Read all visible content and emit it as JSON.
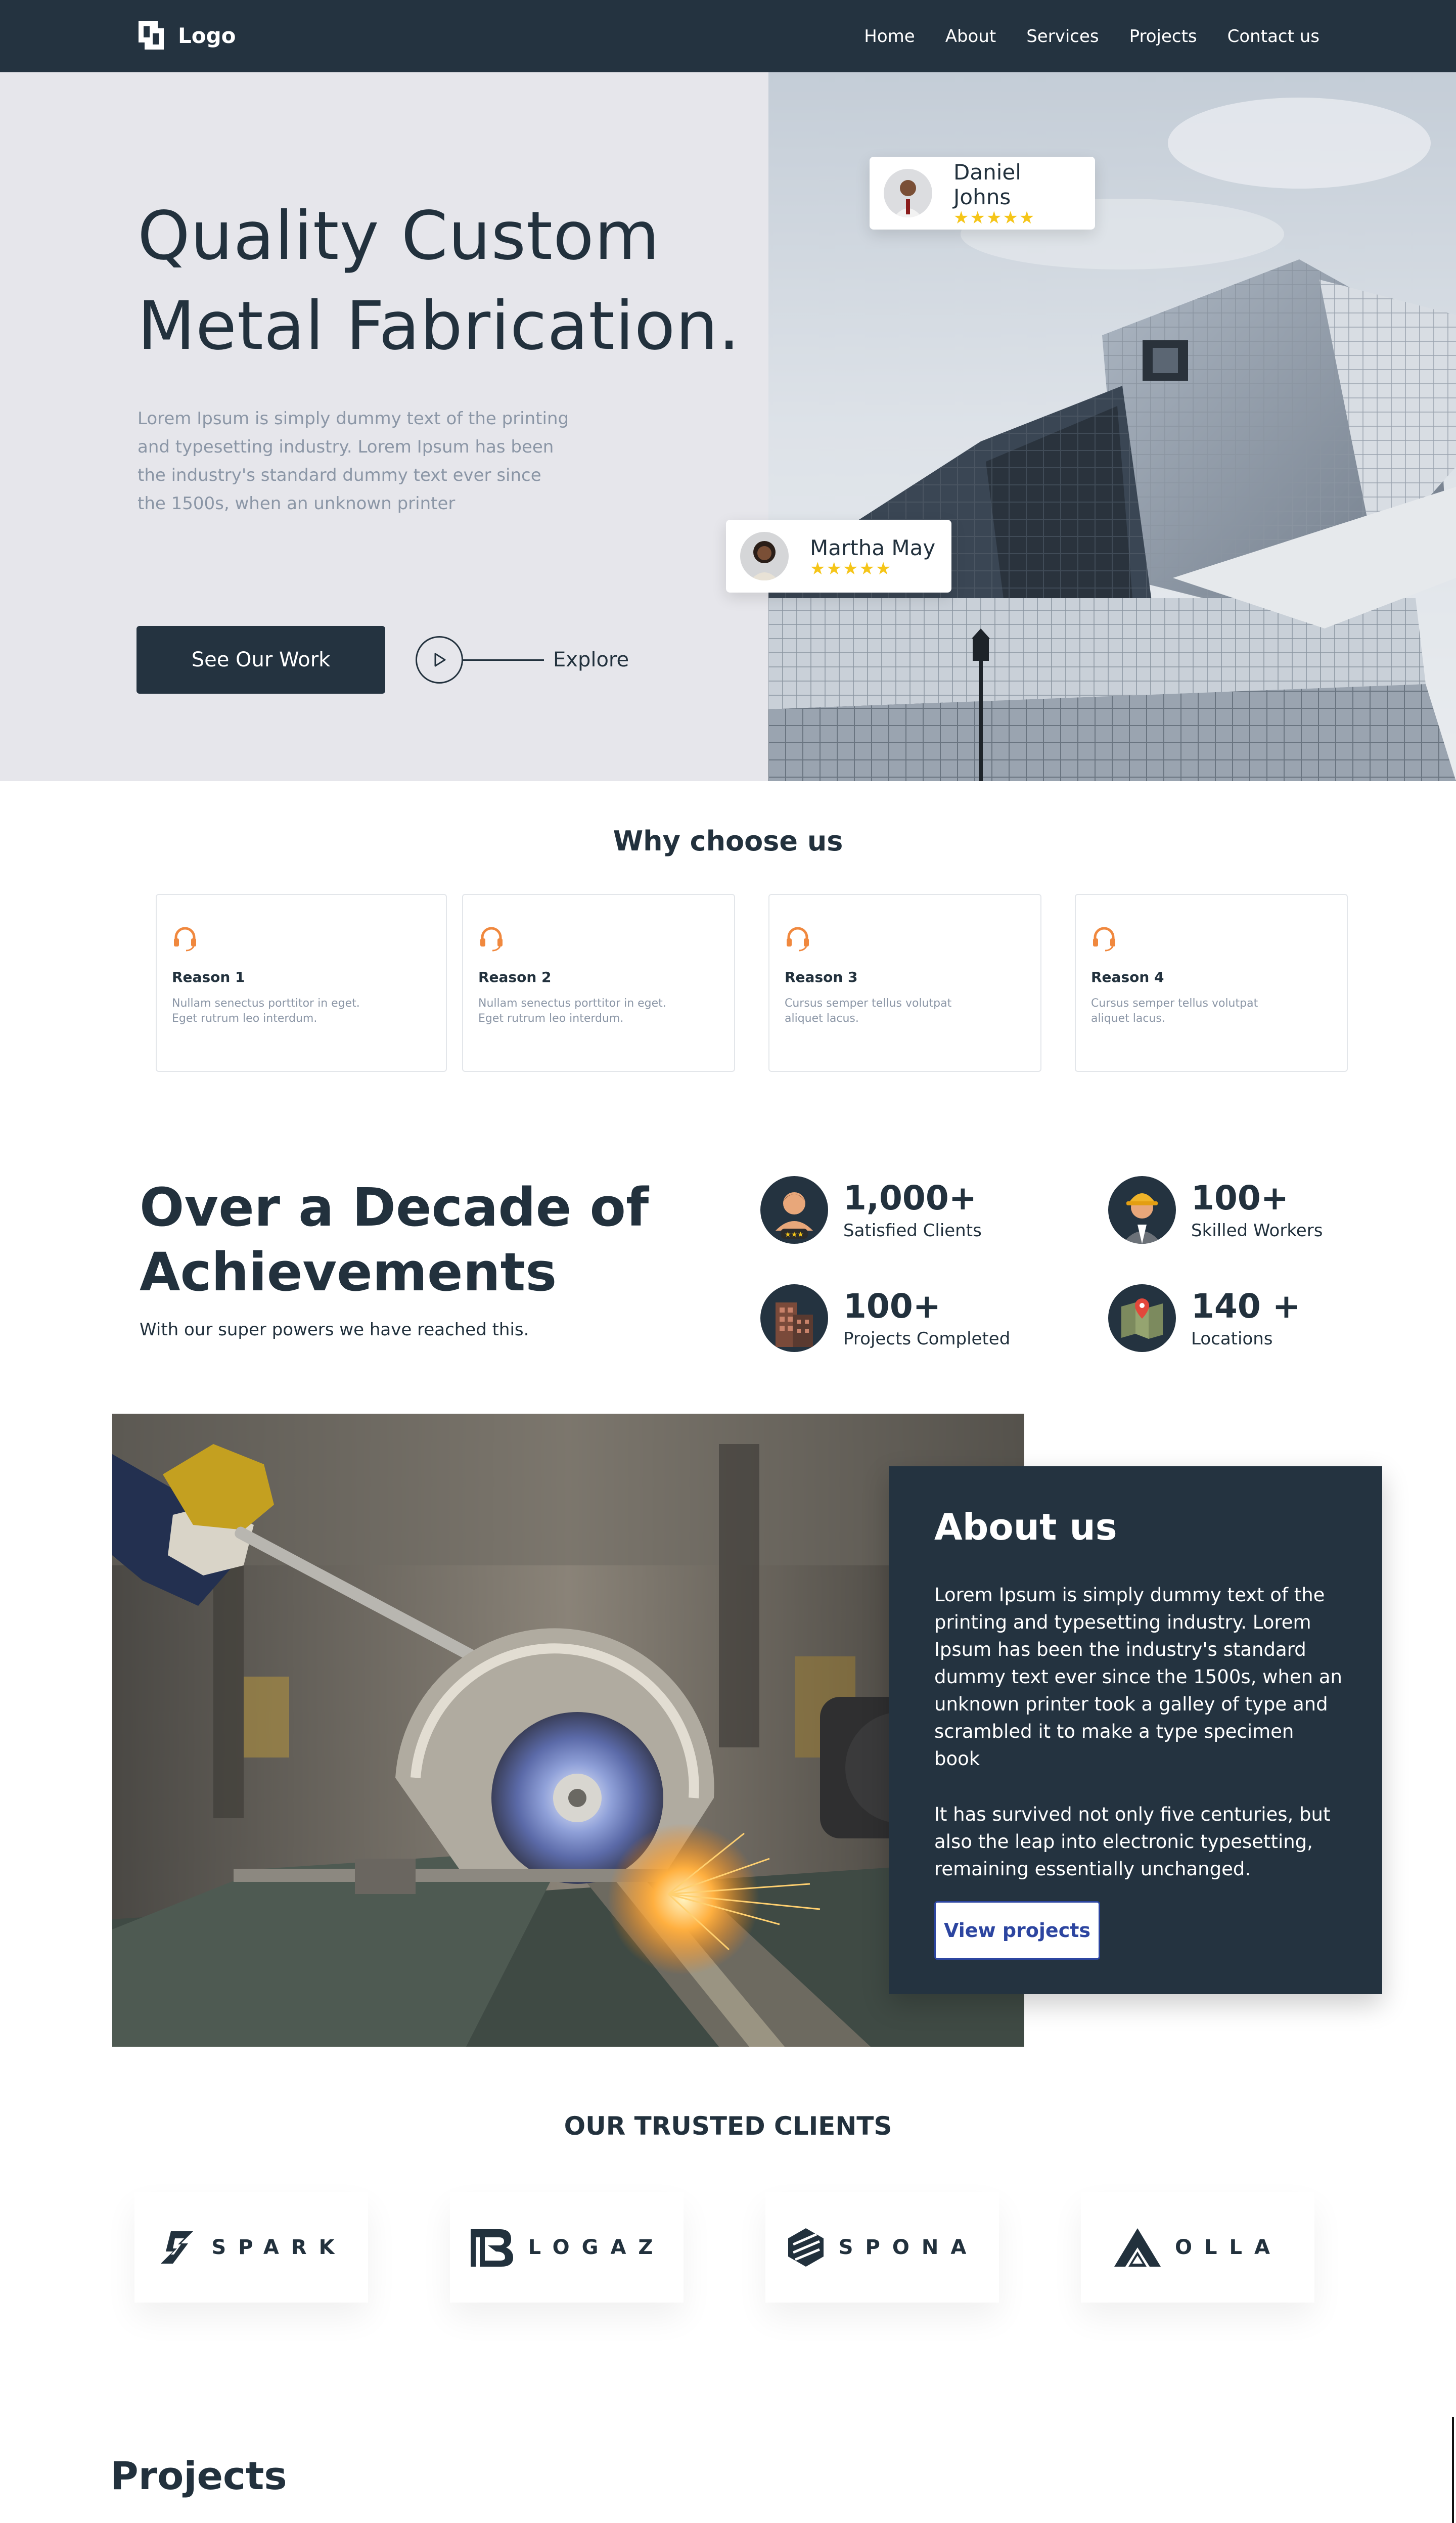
{
  "nav": {
    "logo_text": "Logo",
    "links": [
      "Home",
      "About",
      "Services",
      "Projects",
      "Contact us"
    ]
  },
  "hero": {
    "title_line1": "Quality Custom",
    "title_line2": "Metal Fabrication.",
    "description": "Lorem Ipsum is simply dummy text of the printing and typesetting industry. Lorem Ipsum has been the industry's standard dummy text ever since the 1500s, when an unknown printer",
    "cta_label": "See Our Work",
    "explore_label": "Explore",
    "reviews": [
      {
        "name": "Daniel Johns",
        "stars": "★★★★★",
        "rating": 5
      },
      {
        "name": "Martha May",
        "stars": "★★★★★",
        "rating": 5
      }
    ]
  },
  "why": {
    "title": "Why choose us",
    "reasons": [
      {
        "title": "Reason 1",
        "desc": "Nullam senectus porttitor in eget. Eget rutrum leo interdum."
      },
      {
        "title": "Reason 2",
        "desc": "Nullam senectus porttitor in eget. Eget rutrum leo interdum."
      },
      {
        "title": "Reason 3",
        "desc": "Cursus semper tellus volutpat aliquet lacus."
      },
      {
        "title": "Reason 4",
        "desc": "Cursus semper tellus volutpat aliquet lacus."
      }
    ]
  },
  "achievements": {
    "title_line1": "Over a Decade of",
    "title_line2": "Achievements",
    "subtitle": "With our super powers we have reached this.",
    "stats": [
      {
        "value": "1,000+",
        "label": "Satisfied Clients",
        "icon": "client-icon"
      },
      {
        "value": "100+",
        "label": "Skilled Workers",
        "icon": "worker-icon"
      },
      {
        "value": "100+",
        "label": "Projects Completed",
        "icon": "building-icon"
      },
      {
        "value": "140 +",
        "label": "Locations",
        "icon": "map-icon"
      }
    ]
  },
  "about": {
    "title": "About us",
    "para1": "Lorem Ipsum is simply dummy text of the printing and typesetting industry. Lorem Ipsum has been the industry's standard dummy text ever since the 1500s, when an unknown printer took a galley of type and scrambled it to make a type specimen book",
    "para2": "It has survived not only five centuries, but also the leap into electronic typesetting, remaining essentially unchanged.",
    "button_label": "View projects"
  },
  "clients": {
    "title": "OUR TRUSTED CLIENTS",
    "items": [
      "SPARK",
      "LOGAZ",
      "SPONA",
      "OLLA"
    ]
  },
  "projects": {
    "title": "Projects"
  },
  "colors": {
    "primary_dark": "#243340",
    "hero_bg": "#e6e6eb",
    "accent_orange": "#f0883e",
    "star_yellow": "#f5c518",
    "button_blue": "#2c45a0"
  }
}
